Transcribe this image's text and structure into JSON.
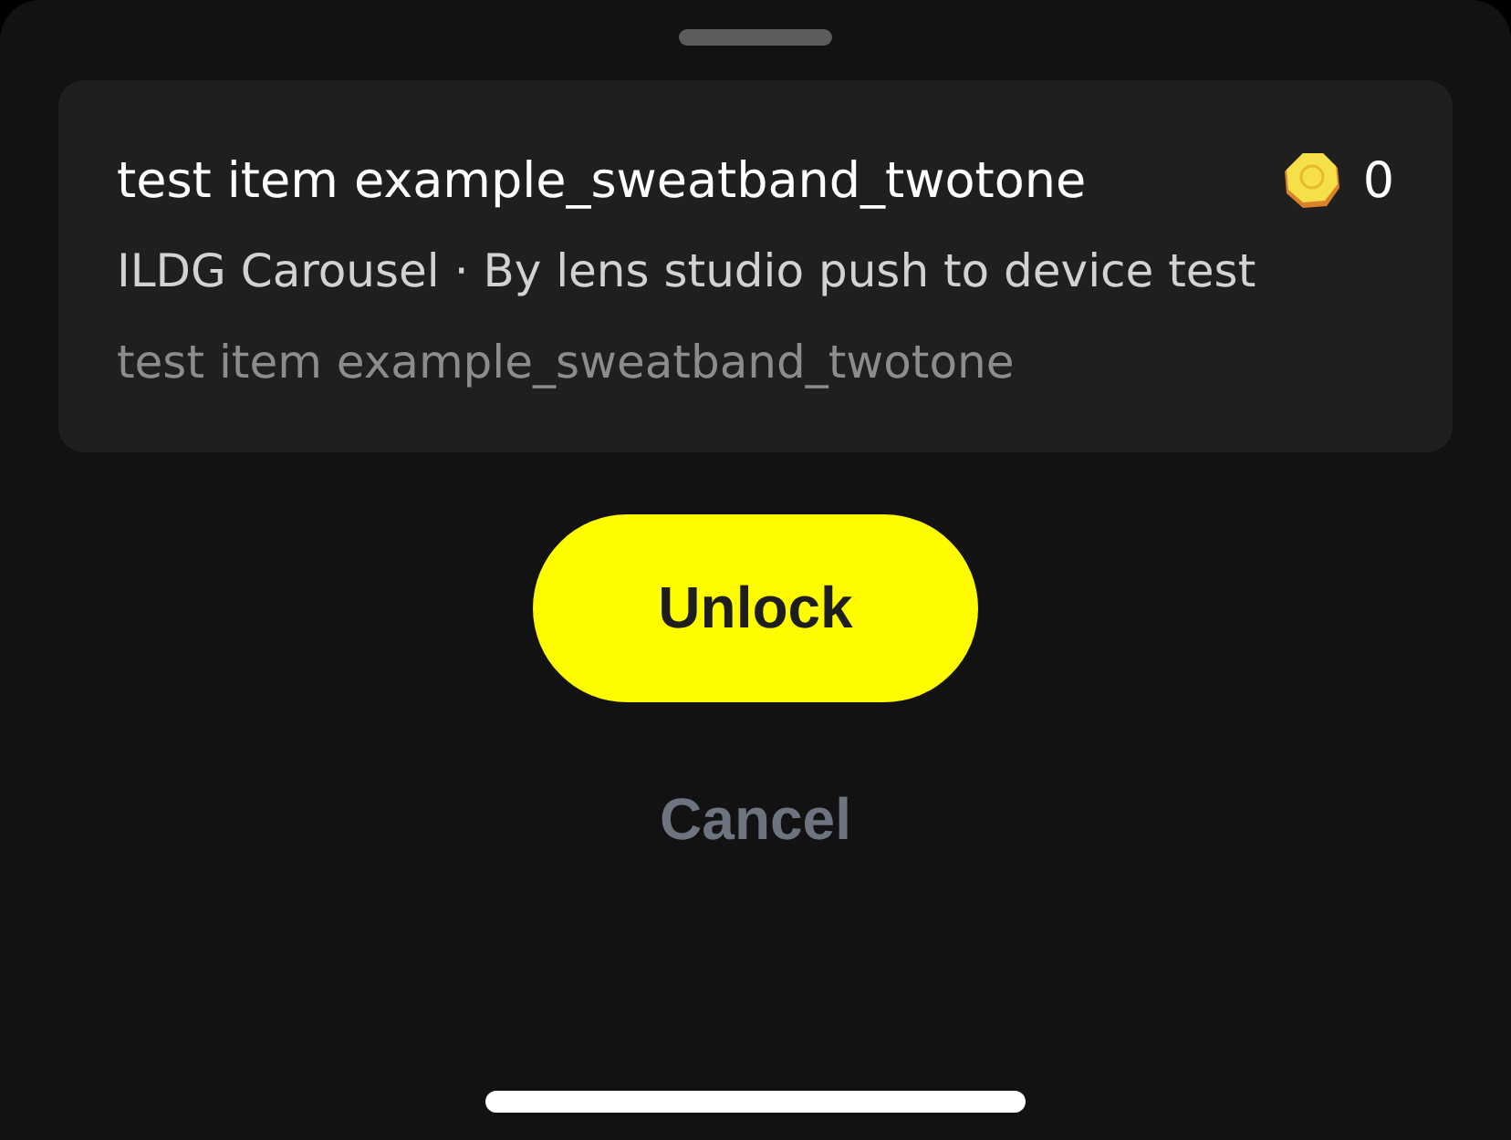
{
  "item": {
    "title": "test item example_sweatband_twotone",
    "price": "0",
    "subtitle": "ILDG Carousel · By lens studio push to device test",
    "description": "test item example_sweatband_twotone"
  },
  "buttons": [
    {
      "label": "Unlock",
      "kind": "primary"
    },
    {
      "label": "Cancel",
      "kind": "text"
    }
  ]
}
